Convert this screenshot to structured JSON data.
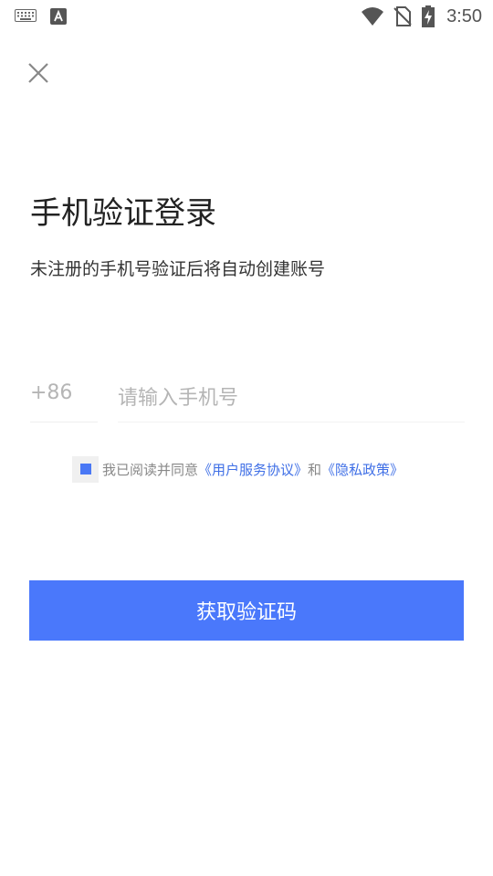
{
  "status_bar": {
    "time": "3:50",
    "icons": [
      "keyboard-icon",
      "font-a-icon",
      "wifi-icon",
      "no-sim-icon",
      "battery-charging-icon"
    ]
  },
  "close_button": {
    "icon": "close-icon"
  },
  "header": {
    "title": "手机验证登录",
    "subtitle": "未注册的手机号验证后将自动创建账号"
  },
  "phone": {
    "country_code": "+86",
    "placeholder": "请输入手机号",
    "value": ""
  },
  "agreement": {
    "checked": true,
    "prefix": "我已阅读并同意",
    "terms_link": "《用户服务协议》",
    "conjunction": "和",
    "privacy_link": "《隐私政策》"
  },
  "submit_button": {
    "label": "获取验证码"
  },
  "colors": {
    "accent": "#4a78fb",
    "link": "#3f6fe6",
    "placeholder": "#b5b5b5",
    "status_icons": "#555555"
  }
}
